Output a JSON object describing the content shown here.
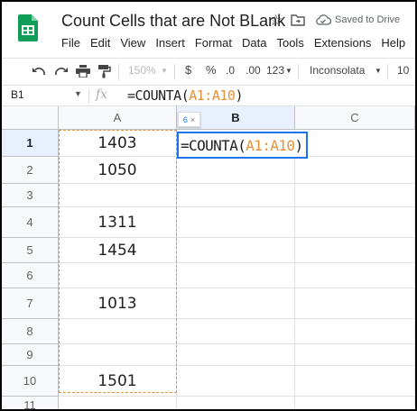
{
  "title": "Count Cells that are Not BLank",
  "saved_status": "Saved to Drive",
  "menu": [
    "File",
    "Edit",
    "View",
    "Insert",
    "Format",
    "Data",
    "Tools",
    "Extensions",
    "Help"
  ],
  "toolbar": {
    "zoom": "150%",
    "currency": "$",
    "percent": "%",
    "decrease_decimal": ".0",
    "increase_decimal": ".00",
    "number_format": "123",
    "font": "Inconsolata",
    "font_size": "10"
  },
  "name_box": "B1",
  "fx": "fx",
  "formula": {
    "prefix": "=COUNTA(",
    "ref": "A1:A10",
    "suffix": ")"
  },
  "tooltip": {
    "count": "6",
    "close": "×"
  },
  "columns": [
    "A",
    "B",
    "C"
  ],
  "rows": [
    "1",
    "2",
    "3",
    "4",
    "5",
    "6",
    "7",
    "8",
    "9",
    "10",
    "11"
  ],
  "cells_a": [
    "1403",
    "1050",
    "",
    "1311",
    "1454",
    "",
    "1013",
    "",
    "",
    "1501",
    ""
  ],
  "colors": {
    "accent": "#1a73e8",
    "range_ref": "#e69138",
    "logo": "#0f9d58"
  }
}
